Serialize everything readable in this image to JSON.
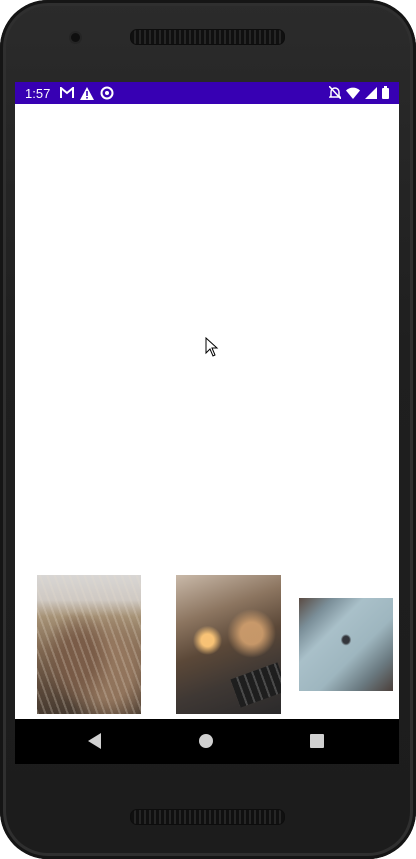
{
  "status_bar": {
    "time": "1:57",
    "color": "#3700b3",
    "left_icons": [
      "gmail-icon",
      "warning-icon",
      "sync-icon"
    ],
    "right_icons": [
      "notifications-off-icon",
      "wifi-icon",
      "signal-icon",
      "battery-icon"
    ]
  },
  "gallery": {
    "items": [
      {
        "name": "field-photo"
      },
      {
        "name": "desk-photo"
      },
      {
        "name": "laptop-photo"
      }
    ]
  },
  "nav_bar": {
    "buttons": [
      "back-button",
      "home-button",
      "recents-button"
    ]
  }
}
